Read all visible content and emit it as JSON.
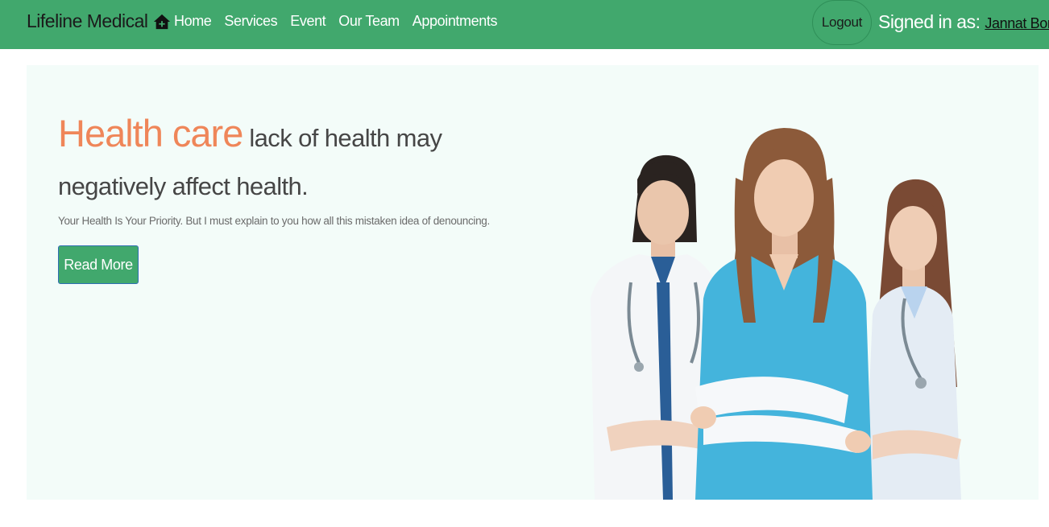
{
  "navbar": {
    "brand": "Lifeline Medical",
    "links": [
      "Home",
      "Services",
      "Event",
      "Our Team",
      "Appointments"
    ],
    "logout_label": "Logout",
    "signed_in_label": "Signed in as:",
    "user_name": "Jannat Borna"
  },
  "hero": {
    "title_accent": "Health care",
    "title_rest": "lack of health may negatively affect health.",
    "subtitle": "Your Health Is Your Priority. But I must explain to you how all this mistaken idea of denouncing.",
    "button_label": "Read More"
  },
  "colors": {
    "nav_green": "#41a86d",
    "accent_orange": "#ef8659",
    "hero_bg": "#f3fcf9",
    "scrub_blue": "#44b4dc"
  },
  "icons": {
    "brand": "home-icon"
  }
}
